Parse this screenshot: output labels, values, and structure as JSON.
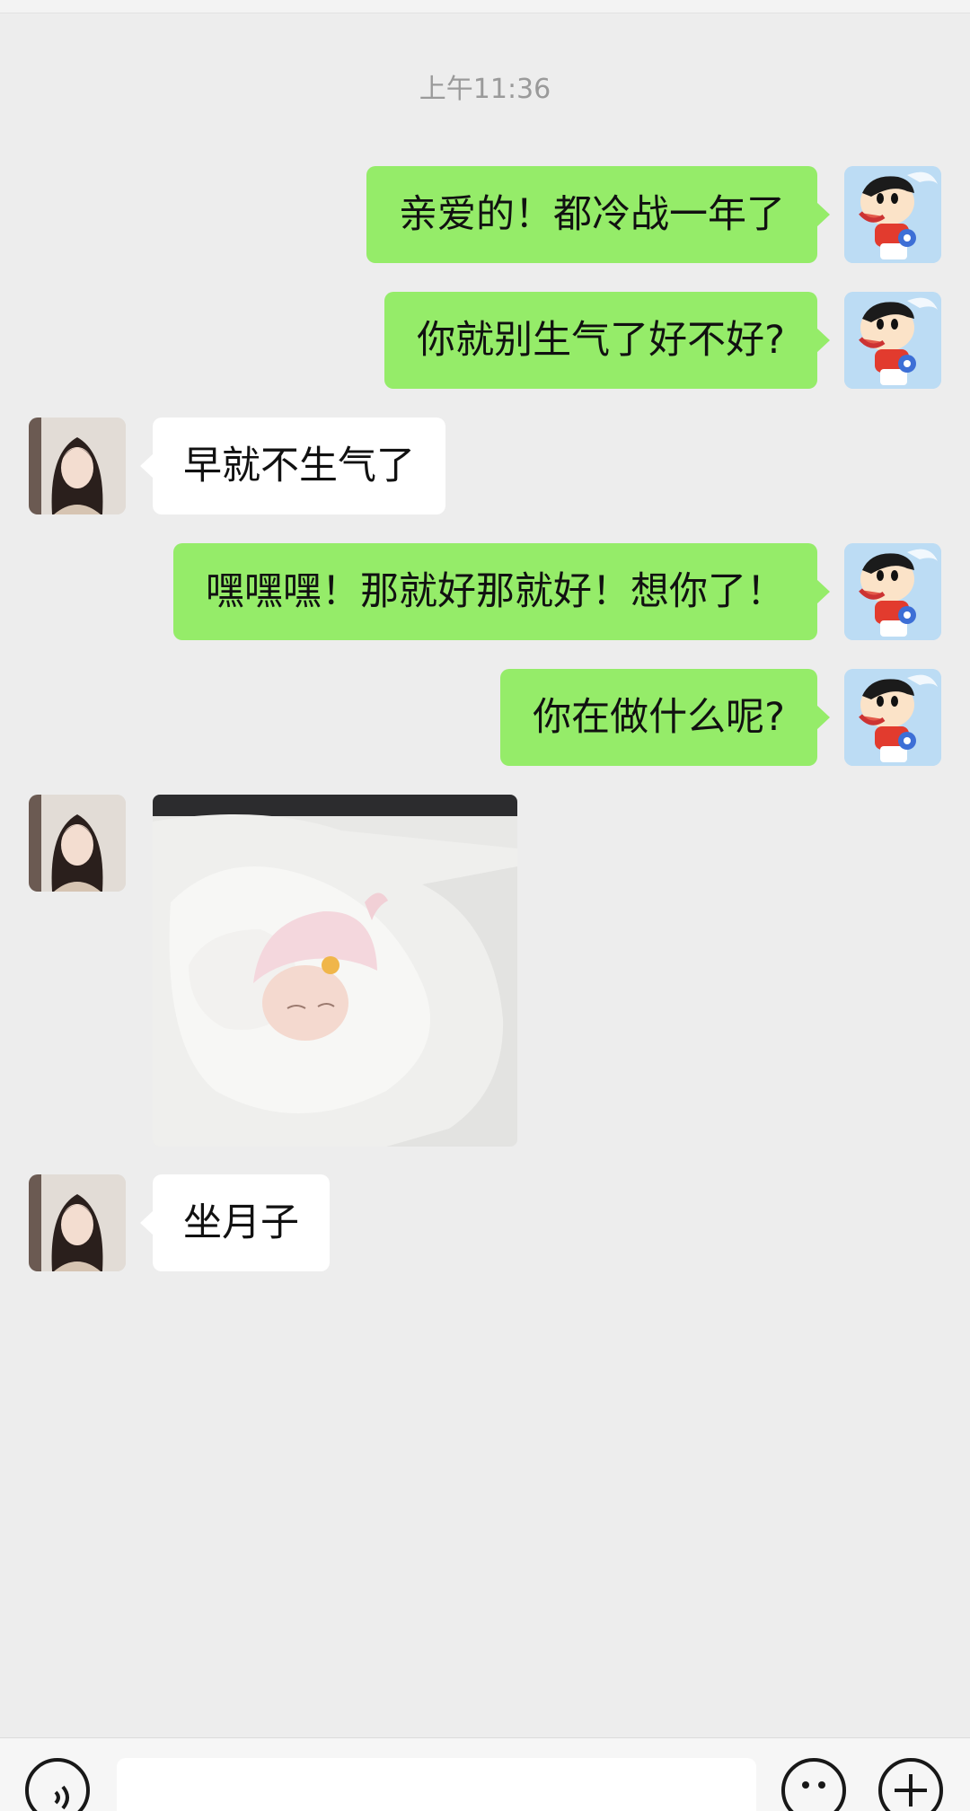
{
  "timestamp": "上午11:36",
  "messages": [
    {
      "direction": "outgoing",
      "text": "亲爱的！都冷战一年了"
    },
    {
      "direction": "outgoing",
      "text": "你就别生气了好不好?"
    },
    {
      "direction": "incoming",
      "text": "早就不生气了"
    },
    {
      "direction": "outgoing",
      "text": "嘿嘿嘿！那就好那就好！想你了！"
    },
    {
      "direction": "outgoing",
      "text": "你在做什么呢?"
    },
    {
      "direction": "incoming",
      "type": "image",
      "image_subject": "sleeping newborn baby in white blanket"
    },
    {
      "direction": "incoming",
      "text": "坐月子"
    }
  ],
  "input_bar": {
    "icons": [
      "voice-icon",
      "emoji-icon",
      "plus-icon"
    ],
    "message_field_value": ""
  },
  "colors": {
    "background": "#ededed",
    "outgoing_bubble": "#95ec69",
    "incoming_bubble": "#ffffff",
    "timestamp_text": "#9a9a9a"
  }
}
